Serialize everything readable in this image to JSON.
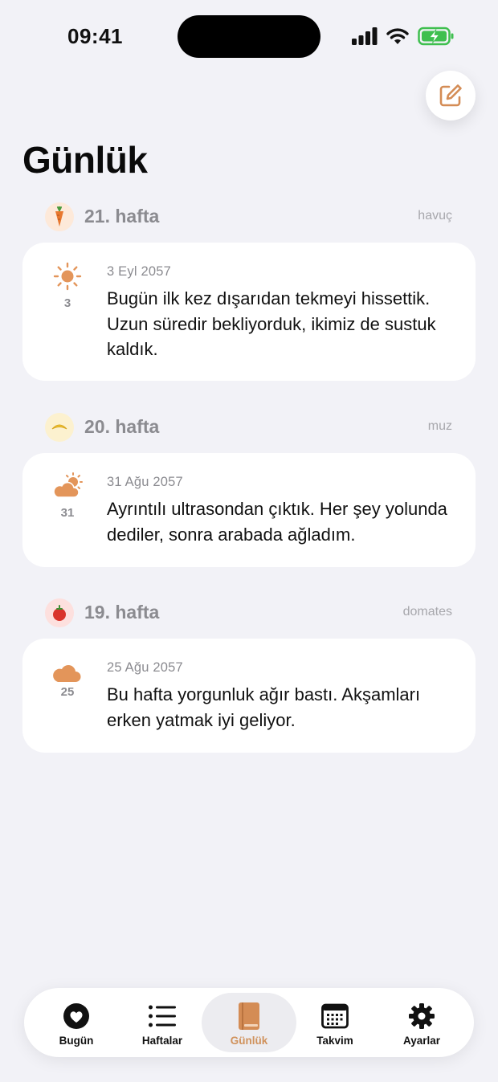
{
  "status_bar": {
    "time": "09:41"
  },
  "page": {
    "title": "Günlük"
  },
  "accent_color": "#d48c55",
  "compose_button": {
    "icon": "compose-icon"
  },
  "sections": [
    {
      "week_label": "21. hafta",
      "fruit_name": "havuç",
      "fruit_icon": "carrot-icon",
      "entries": [
        {
          "weather_icon": "sun-icon",
          "day": "3",
          "date": "3 Eyl 2057",
          "text": "Bugün ilk kez dışarıdan tekmeyi hissettik. Uzun süredir bekliyorduk, ikimiz de sustuk kaldık."
        }
      ]
    },
    {
      "week_label": "20. hafta",
      "fruit_name": "muz",
      "fruit_icon": "banana-icon",
      "entries": [
        {
          "weather_icon": "partly-sunny-icon",
          "day": "31",
          "date": "31 Ağu 2057",
          "text": "Ayrıntılı ultrasondan çıktık. Her şey yolunda dediler, sonra arabada ağladım."
        }
      ]
    },
    {
      "week_label": "19. hafta",
      "fruit_name": "domates",
      "fruit_icon": "tomato-icon",
      "entries": [
        {
          "weather_icon": "cloud-icon",
          "day": "25",
          "date": "25 Ağu 2057",
          "text": "Bu hafta yorgunluk ağır bastı. Akşamları erken yatmak iyi geliyor."
        }
      ]
    }
  ],
  "tab_bar": {
    "active": "Günlük",
    "tabs": [
      {
        "label": "Bugün",
        "icon": "heart-icon"
      },
      {
        "label": "Haftalar",
        "icon": "list-icon"
      },
      {
        "label": "Günlük",
        "icon": "book-icon"
      },
      {
        "label": "Takvim",
        "icon": "calendar-icon"
      },
      {
        "label": "Ayarlar",
        "icon": "gear-icon"
      }
    ]
  }
}
